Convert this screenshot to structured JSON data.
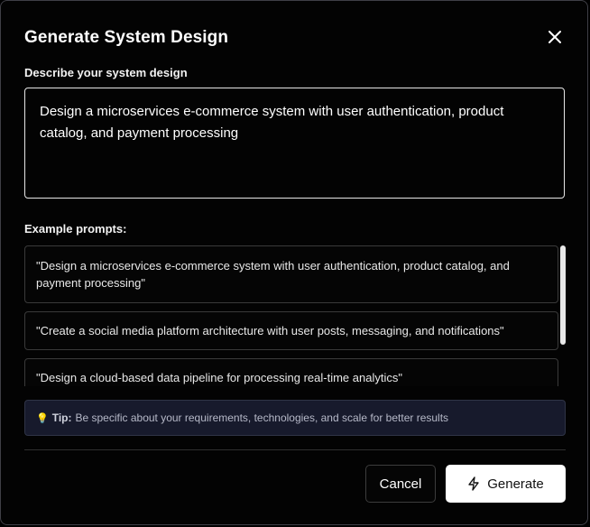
{
  "dialog": {
    "title": "Generate System Design",
    "close_icon": "close-icon"
  },
  "description": {
    "label": "Describe your system design",
    "value": "Design a microservices e-commerce system with user authentication, product catalog, and payment processing"
  },
  "examples": {
    "label": "Example prompts:",
    "items": [
      "\"Design a microservices e-commerce system with user authentication, product catalog, and payment processing\"",
      "\"Create a social media platform architecture with user posts, messaging, and notifications\"",
      "\"Design a cloud-based data pipeline for processing real-time analytics\""
    ]
  },
  "tip": {
    "icon": "lightbulb-icon",
    "label": "Tip:",
    "text": "Be specific about your requirements, technologies, and scale for better results"
  },
  "footer": {
    "cancel_label": "Cancel",
    "generate_label": "Generate",
    "generate_icon": "lightning-icon"
  }
}
